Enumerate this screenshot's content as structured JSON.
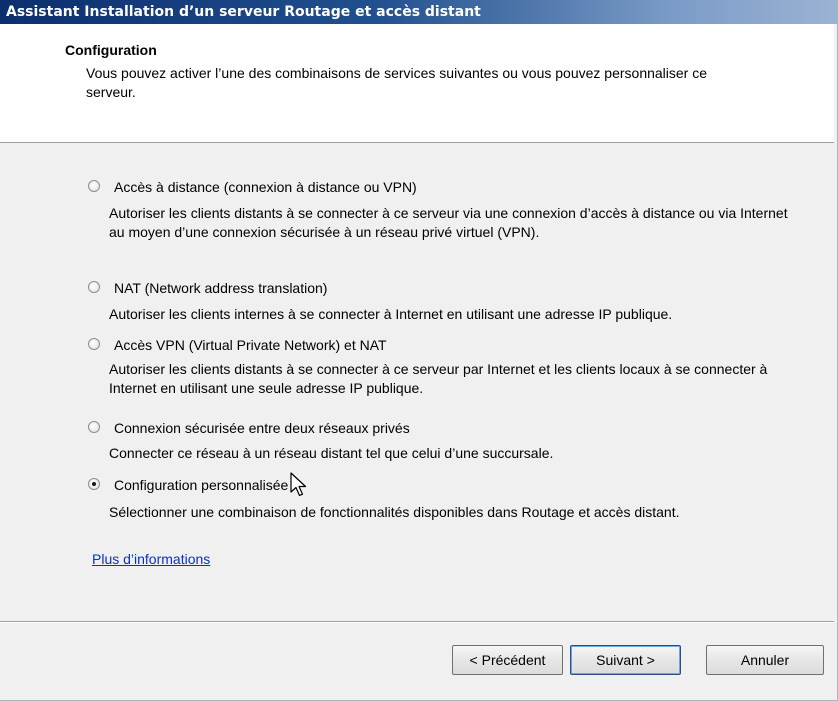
{
  "window": {
    "title": "Assistant Installation d’un serveur Routage et accès distant"
  },
  "header": {
    "title": "Configuration",
    "description": "Vous pouvez activer l’une des combinaisons de services suivantes ou vous pouvez personnaliser ce serveur."
  },
  "options": [
    {
      "label": "Accès à distance (connexion à distance ou VPN)",
      "description": "Autoriser les clients distants à se connecter à ce serveur via une connexion d’accès à distance ou via Internet au moyen d’une connexion sécurisée à un réseau privé virtuel (VPN).",
      "selected": false
    },
    {
      "label": "NAT (Network address translation)",
      "description": "Autoriser les clients internes à se connecter à Internet en utilisant une adresse IP publique.",
      "selected": false
    },
    {
      "label": "Accès VPN (Virtual Private Network) et NAT",
      "description": "Autoriser les clients distants à se connecter à ce serveur par Internet et les clients locaux à se connecter à Internet en utilisant une seule adresse IP publique.",
      "selected": false
    },
    {
      "label": "Connexion sécurisée entre deux réseaux privés",
      "description": "Connecter ce réseau à un réseau distant tel que celui d’une succursale.",
      "selected": false
    },
    {
      "label": "Configuration personnalisée",
      "description": "Sélectionner une combinaison de fonctionnalités disponibles dans Routage et accès distant.",
      "selected": true
    }
  ],
  "more_info_link": "Plus d’informations",
  "buttons": {
    "back": "< Précédent",
    "next": "Suivant >",
    "cancel": "Annuler"
  },
  "colors": {
    "title_bar_start": "#0c2e6e",
    "title_bar_end": "#9bb3d4",
    "dialog_bg": "#f0f0f0",
    "link": "#0033cc"
  },
  "icons": {
    "cursor": "arrow-cursor-icon"
  }
}
